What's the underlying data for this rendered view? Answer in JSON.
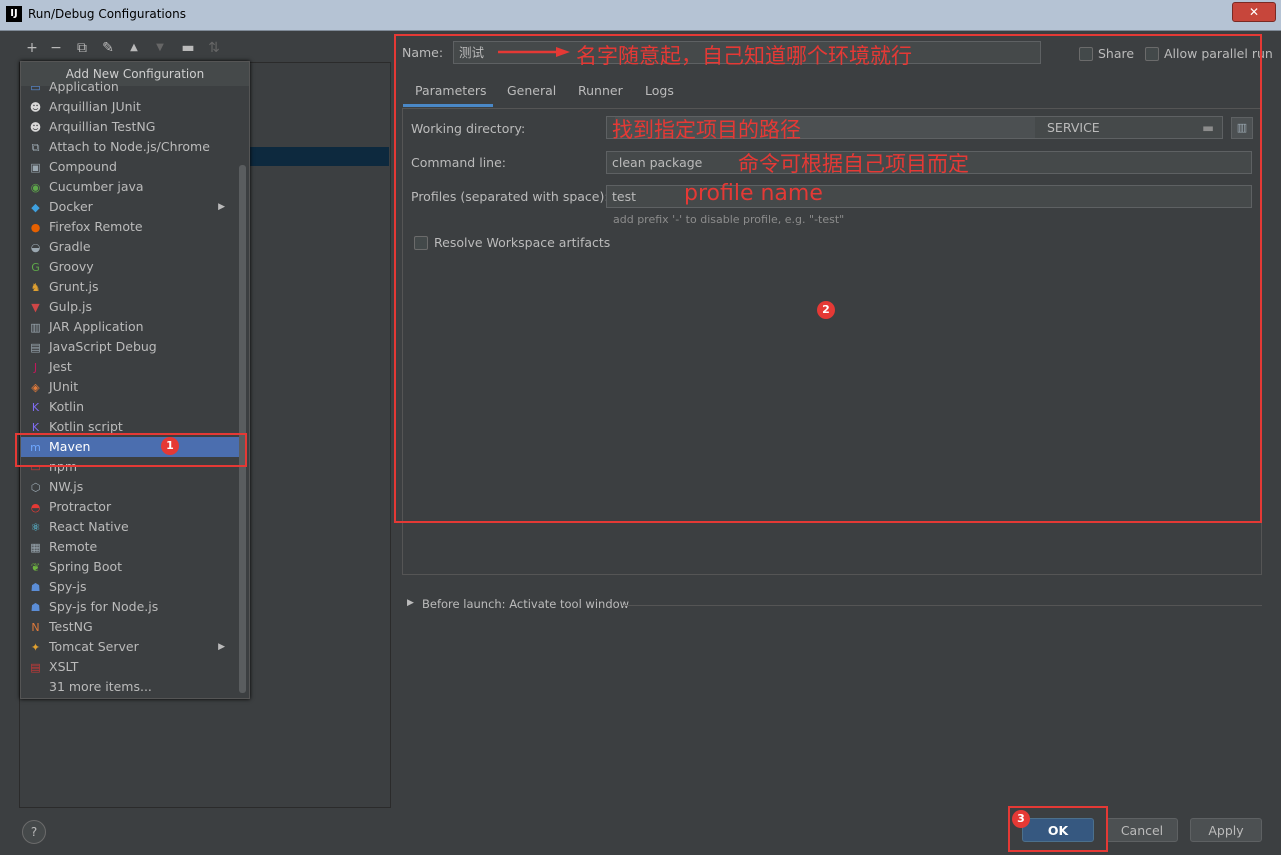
{
  "window": {
    "title": "Run/Debug Configurations",
    "app_icon": "IJ",
    "close_label": "✕"
  },
  "toolbar": {
    "icons": [
      "add-icon",
      "remove-icon",
      "copy-icon",
      "wrench-icon",
      "move-up-icon",
      "move-down-icon",
      "folder-icon",
      "sort-icon"
    ]
  },
  "popup": {
    "header": "Add New Configuration",
    "items": [
      {
        "label": "Application",
        "icon": "application-icon",
        "color": "#5b8dd6",
        "glyph": "▭"
      },
      {
        "label": "Arquillian JUnit",
        "icon": "arquillian-icon",
        "color": "#d9d9d9",
        "glyph": "☻"
      },
      {
        "label": "Arquillian TestNG",
        "icon": "arquillian-icon",
        "color": "#d9d9d9",
        "glyph": "☻"
      },
      {
        "label": "Attach to Node.js/Chrome",
        "icon": "attach-icon",
        "color": "#9aa7b0",
        "glyph": "⧉"
      },
      {
        "label": "Compound",
        "icon": "compound-icon",
        "color": "#9aa7b0",
        "glyph": "▣"
      },
      {
        "label": "Cucumber java",
        "icon": "cucumber-icon",
        "color": "#5ea84a",
        "glyph": "◉"
      },
      {
        "label": "Docker",
        "icon": "docker-icon",
        "color": "#3ea0df",
        "glyph": "◆",
        "submenu": true
      },
      {
        "label": "Firefox Remote",
        "icon": "firefox-icon",
        "color": "#e66000",
        "glyph": "●"
      },
      {
        "label": "Gradle",
        "icon": "gradle-icon",
        "color": "#9aa7b0",
        "glyph": "◒"
      },
      {
        "label": "Groovy",
        "icon": "groovy-icon",
        "color": "#5ea84a",
        "glyph": "G"
      },
      {
        "label": "Grunt.js",
        "icon": "grunt-icon",
        "color": "#e0a030",
        "glyph": "♞"
      },
      {
        "label": "Gulp.js",
        "icon": "gulp-icon",
        "color": "#cf4647",
        "glyph": "▼"
      },
      {
        "label": "JAR Application",
        "icon": "jar-icon",
        "color": "#9aa7b0",
        "glyph": "▥"
      },
      {
        "label": "JavaScript Debug",
        "icon": "js-debug-icon",
        "color": "#9aa7b0",
        "glyph": "▤"
      },
      {
        "label": "Jest",
        "icon": "jest-icon",
        "color": "#c2185b",
        "glyph": "J"
      },
      {
        "label": "JUnit",
        "icon": "junit-icon",
        "color": "#e07a3a",
        "glyph": "◈"
      },
      {
        "label": "Kotlin",
        "icon": "kotlin-icon",
        "color": "#7f6cf0",
        "glyph": "K"
      },
      {
        "label": "Kotlin script",
        "icon": "kotlin-script-icon",
        "color": "#7f6cf0",
        "glyph": "K"
      },
      {
        "label": "Maven",
        "icon": "maven-icon",
        "color": "#6fa8ff",
        "glyph": "m",
        "selected": true
      },
      {
        "label": "npm",
        "icon": "npm-icon",
        "color": "#cb3837",
        "glyph": "▭"
      },
      {
        "label": "NW.js",
        "icon": "nwjs-icon",
        "color": "#9aa7b0",
        "glyph": "⬡"
      },
      {
        "label": "Protractor",
        "icon": "protractor-icon",
        "color": "#e53935",
        "glyph": "◓"
      },
      {
        "label": "React Native",
        "icon": "react-icon",
        "color": "#61dafb",
        "glyph": "⚛"
      },
      {
        "label": "Remote",
        "icon": "remote-icon",
        "color": "#9aa7b0",
        "glyph": "▦"
      },
      {
        "label": "Spring Boot",
        "icon": "spring-boot-icon",
        "color": "#6db33f",
        "glyph": "❦"
      },
      {
        "label": "Spy-js",
        "icon": "spy-js-icon",
        "color": "#5b8dd6",
        "glyph": "☗"
      },
      {
        "label": "Spy-js for Node.js",
        "icon": "spy-js-node-icon",
        "color": "#5b8dd6",
        "glyph": "☗"
      },
      {
        "label": "TestNG",
        "icon": "testng-icon",
        "color": "#e07a3a",
        "glyph": "N"
      },
      {
        "label": "Tomcat Server",
        "icon": "tomcat-icon",
        "color": "#e0a030",
        "glyph": "✦",
        "submenu": true
      },
      {
        "label": "XSLT",
        "icon": "xslt-icon",
        "color": "#cb3837",
        "glyph": "▤"
      },
      {
        "label": "31 more items...",
        "icon": "",
        "color": "#bbbbbb",
        "glyph": ""
      }
    ]
  },
  "form": {
    "name_label": "Name:",
    "name_value": "测试",
    "share_label": "Share",
    "parallel_label": "Allow parallel run",
    "tabs": [
      "Parameters",
      "General",
      "Runner",
      "Logs"
    ],
    "workdir_label": "Working directory:",
    "workdir_value": "SERVICE",
    "cmdline_label": "Command line:",
    "cmdline_value": "clean package",
    "profiles_label": "Profiles (separated with space):",
    "profiles_value": "test",
    "profiles_hint": "add prefix '-' to disable profile, e.g. \"-test\"",
    "resolve_label": "Resolve Workspace artifacts",
    "before_launch": "Before launch: Activate tool window"
  },
  "annotations": {
    "name_note": "名字随意起，自己知道哪个环境就行",
    "workdir_note": "找到指定项目的路径",
    "cmd_note": "命令可根据自己项目而定",
    "profile_note": "profile name",
    "badge1": "1",
    "badge2": "2",
    "badge3": "3"
  },
  "buttons": {
    "ok": "OK",
    "cancel": "Cancel",
    "apply": "Apply",
    "help": "?"
  }
}
